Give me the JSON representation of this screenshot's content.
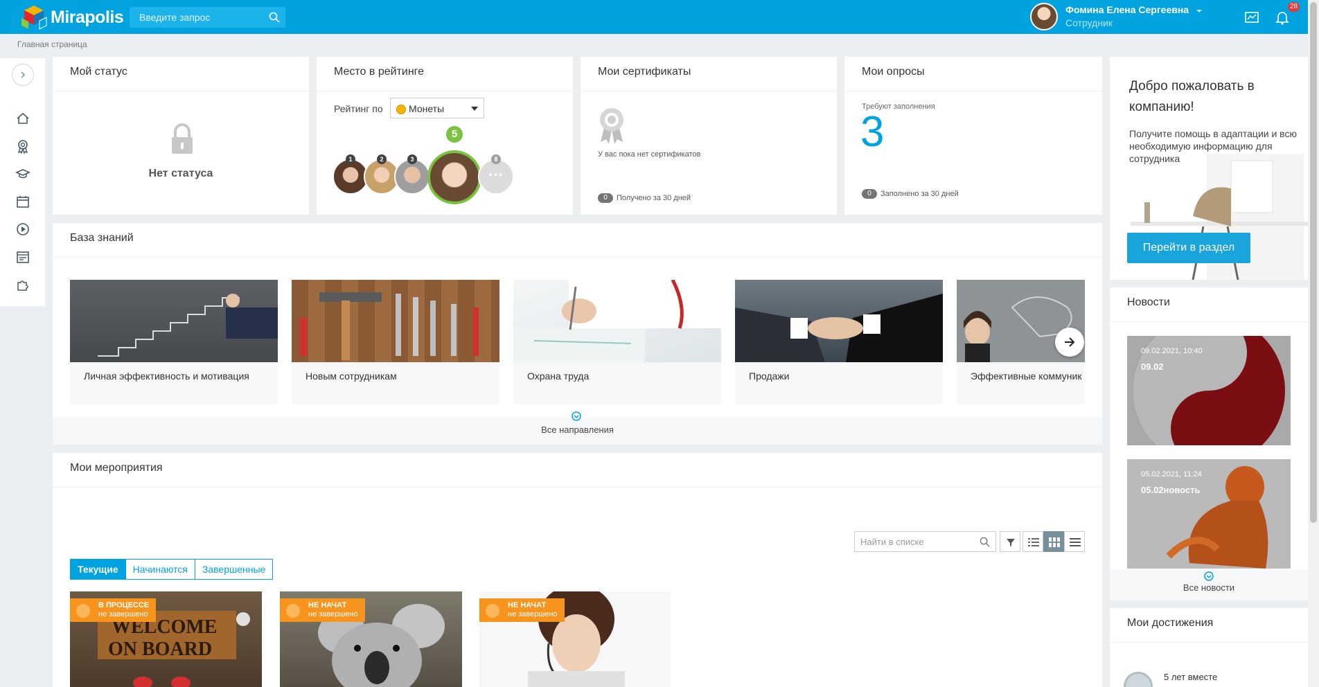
{
  "app": {
    "name": "Mirapolis",
    "brand_color": "#00a3e0"
  },
  "header": {
    "search_placeholder": "Введите запрос",
    "user_name": "Фомина Елена Сергеевна",
    "user_role": "Сотрудник",
    "notifications_count": "28"
  },
  "breadcrumb": "Главная страница",
  "sidebar": {
    "items": [
      "home-icon",
      "award-icon",
      "education-icon",
      "calendar-icon",
      "play-icon",
      "schedule-icon",
      "puzzle-icon"
    ]
  },
  "status_card": {
    "title": "Мой статус",
    "text": "Нет статуса"
  },
  "rating_card": {
    "title": "Место в рейтинге",
    "label": "Рейтинг по",
    "selected": "Монеты",
    "places": [
      "1",
      "2",
      "3",
      "5",
      "8"
    ]
  },
  "certs_card": {
    "title": "Мои сертификаты",
    "empty": "У вас пока нет сертификатов",
    "count": "0",
    "footer": "Получено за 30 дней"
  },
  "surveys_card": {
    "title": "Мои опросы",
    "label": "Требуют заполнения",
    "value": "3",
    "count": "0",
    "footer": "Заполнено за 30 дней"
  },
  "knowledge": {
    "title": "База знаний",
    "items": [
      "Личная эффективность и мотивация",
      "Новым сотрудникам",
      "Охрана труда",
      "Продажи",
      "Эффективные коммуник"
    ],
    "all": "Все направления"
  },
  "events": {
    "title": "Мои мероприятия",
    "search_placeholder": "Найти в списке",
    "tabs": [
      "Текущие",
      "Начинаются",
      "Завершенные"
    ],
    "cards": [
      {
        "status": "В ПРОЦЕССЕ",
        "sub": "не завершено"
      },
      {
        "status": "НЕ НАЧАТ",
        "sub": "не завершено"
      },
      {
        "status": "НЕ НАЧАТ",
        "sub": "не завершено"
      }
    ]
  },
  "welcome": {
    "title": "Добро пожаловать в компанию!",
    "text": "Получите помощь в адаптации и всю необходимую информацию для сотрудника",
    "button": "Перейти в раздел"
  },
  "news": {
    "title": "Новости",
    "items": [
      {
        "date": "09.02.2021, 10:40",
        "title": "09.02"
      },
      {
        "date": "05.02.2021, 11:24",
        "title": "05.02новость"
      }
    ],
    "all": "Все новости"
  },
  "achievements": {
    "title": "Мои достижения",
    "first": "5 лет вместе"
  }
}
